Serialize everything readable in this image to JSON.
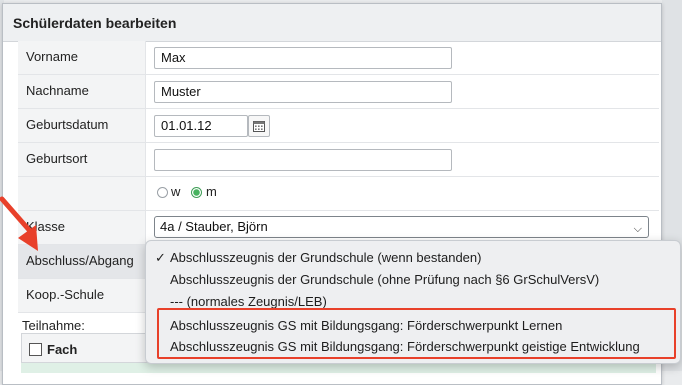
{
  "dialog": {
    "title": "Schülerdaten bearbeiten"
  },
  "form": {
    "vorname": {
      "label": "Vorname",
      "value": "Max"
    },
    "nachname": {
      "label": "Nachname",
      "value": "Muster"
    },
    "geburtsdatum": {
      "label": "Geburtsdatum",
      "value": "01.01.12"
    },
    "geburtsort": {
      "label": "Geburtsort",
      "value": ""
    },
    "gender": {
      "options": [
        "w",
        "m"
      ],
      "selected": "m"
    },
    "klasse": {
      "label": "Klasse",
      "value": "4a / Stauber, Björn"
    },
    "abschluss": {
      "label": "Abschluss/Abgang"
    },
    "koop": {
      "label": "Koop.-Schule"
    }
  },
  "teilnahme": {
    "label": "Teilnahme:",
    "column_fach": "Fach"
  },
  "dropdown": {
    "options": [
      "Abschlusszeugnis der Grundschule (wenn bestanden)",
      "Abschlusszeugnis der Grundschule (ohne Prüfung nach §6 GrSchulVersV)",
      "--- (normales Zeugnis/LEB)",
      "Abschlusszeugnis GS mit Bildungsgang: Förderschwerpunkt Lernen",
      "Abschlusszeugnis GS mit Bildungsgang: Förderschwerpunkt geistige Entwicklung"
    ],
    "selected_index": 0,
    "check_mark": "✓"
  },
  "icons": {
    "calendar": "calendar-icon",
    "chevron": "chevron-down-icon"
  },
  "colors": {
    "annotation_red": "#e8402a",
    "radio_green": "#47b35f"
  }
}
